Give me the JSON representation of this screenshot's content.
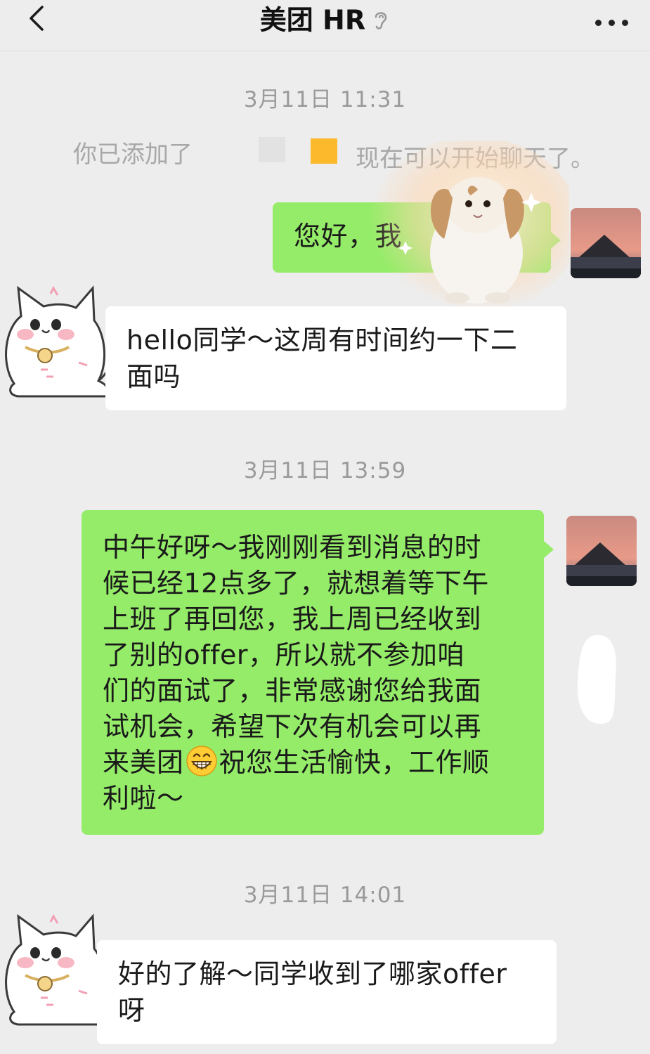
{
  "header": {
    "title": "美团 HR",
    "back_icon": "chevron-left-icon",
    "more_icon": "more-dots-icon",
    "ear_icon": "ear-icon"
  },
  "colors": {
    "background": "#ededed",
    "my_bubble": "#95ec69",
    "their_bubble": "#ffffff",
    "timestamp_text": "#9a9a9a"
  },
  "timestamps": {
    "t1": "3月11日 11:31",
    "t2": "3月11日 13:59",
    "t3": "3月11日 14:01"
  },
  "system_note": {
    "prefix": "你已添加了",
    "suffix": "现在可以开始聊天了。"
  },
  "messages": {
    "m1": "您好，我",
    "m2_line1": "hello同学～这周有时间约一下二",
    "m2_line2": "面吗",
    "m3_l1": "中午好呀～我刚刚看到消息的时",
    "m3_l2": "候已经12点多了，就想着等下午",
    "m3_l3": "上班了再回您，我上周已经收到",
    "m3_l4": "了别的offer，所以就不参加咱",
    "m3_l5": "们的面试了，非常感谢您给我面",
    "m3_l6": "试机会，希望下次有机会可以再",
    "m3_l7a": "来美团",
    "m3_l7b": "祝您生活愉快，工作顺",
    "m3_l8": "利啦～",
    "m4_line1": "好的了解～同学收到了哪家offer",
    "m4_line2": "呀"
  }
}
